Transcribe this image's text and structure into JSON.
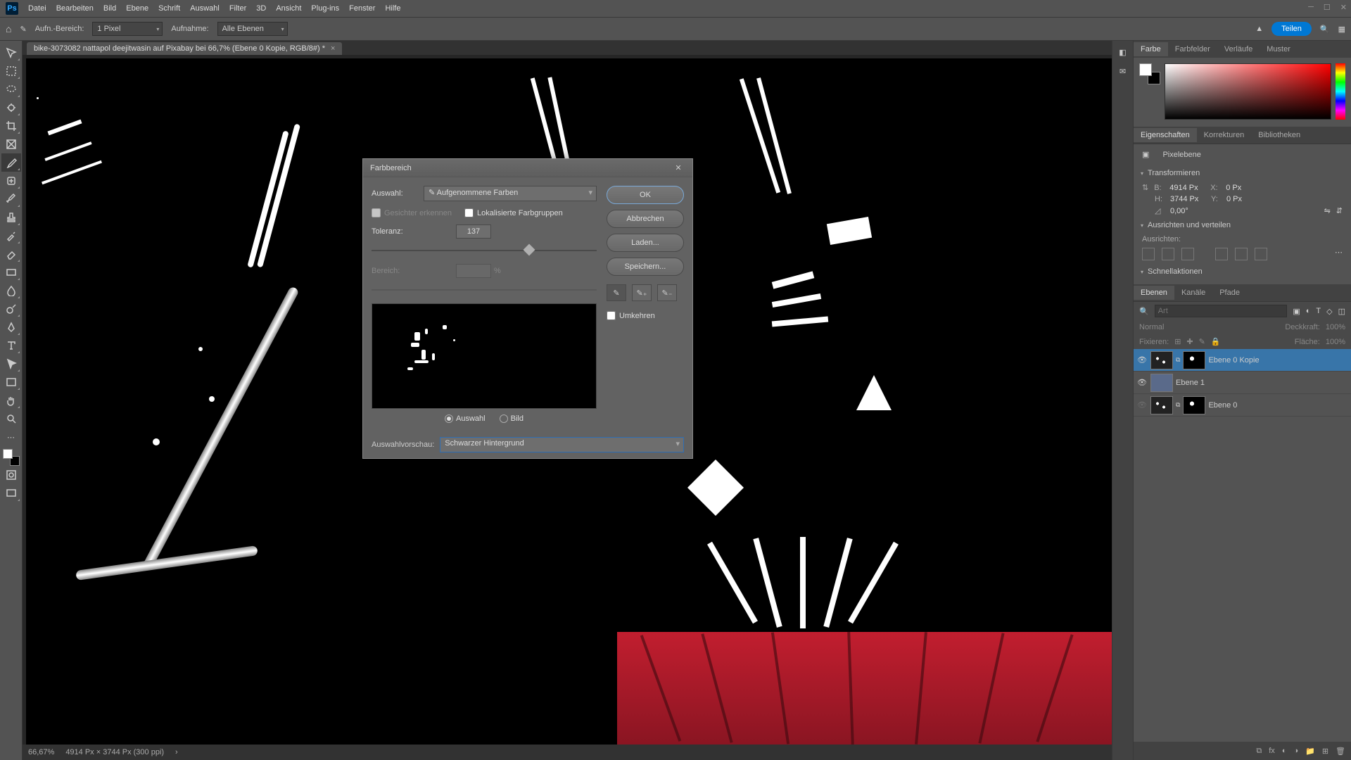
{
  "menu": {
    "items": [
      "Datei",
      "Bearbeiten",
      "Bild",
      "Ebene",
      "Schrift",
      "Auswahl",
      "Filter",
      "3D",
      "Ansicht",
      "Plug-ins",
      "Fenster",
      "Hilfe"
    ]
  },
  "optionsbar": {
    "aufn_label": "Aufn.-Bereich:",
    "aufn_value": "1 Pixel",
    "aufnahme_label": "Aufnahme:",
    "aufnahme_value": "Alle Ebenen",
    "share": "Teilen"
  },
  "document": {
    "tab_title": "bike-3073082 nattapol deejitwasin auf Pixabay bei 66,7% (Ebene 0 Kopie, RGB/8#) *"
  },
  "status": {
    "zoom": "66,67%",
    "doc": "4914 Px × 3744 Px (300 ppi)"
  },
  "panels": {
    "color_tabs": [
      "Farbe",
      "Farbfelder",
      "Verläufe",
      "Muster"
    ],
    "props_tabs": [
      "Eigenschaften",
      "Korrekturen",
      "Bibliotheken"
    ],
    "props_header": "Pixelebene",
    "transform": "Transformieren",
    "b_label": "B:",
    "b_val": "4914 Px",
    "x_label": "X:",
    "x_val": "0 Px",
    "h_label": "H:",
    "h_val": "3744 Px",
    "y_label": "Y:",
    "y_val": "0 Px",
    "angle": "0,00°",
    "align": "Ausrichten und verteilen",
    "align_sub": "Ausrichten:",
    "quick": "Schnellaktionen",
    "layer_tabs": [
      "Ebenen",
      "Kanäle",
      "Pfade"
    ],
    "layer_search_ph": "Art",
    "blend": "Normal",
    "opacity_label": "Deckkraft:",
    "opacity": "100%",
    "lock_label": "Fixieren:",
    "fill_label": "Fläche:",
    "fill": "100%",
    "layers": [
      {
        "name": "Ebene 0 Kopie",
        "vis": true,
        "mask": true,
        "sel": true
      },
      {
        "name": "Ebene 1",
        "vis": true,
        "mask": false,
        "sel": false,
        "solid": true
      },
      {
        "name": "Ebene 0",
        "vis": false,
        "mask": true,
        "sel": false
      }
    ]
  },
  "dialog": {
    "title": "Farbbereich",
    "auswahl_label": "Auswahl:",
    "auswahl_value": "Aufgenommene Farben",
    "gesichter": "Gesichter erkennen",
    "lokalisierte": "Lokalisierte Farbgruppen",
    "toleranz_label": "Toleranz:",
    "toleranz_value": "137",
    "toleranz_pct": 68,
    "bereich_label": "Bereich:",
    "bereich_unit": "%",
    "radio_auswahl": "Auswahl",
    "radio_bild": "Bild",
    "vorschau_label": "Auswahlvorschau:",
    "vorschau_value": "Schwarzer Hintergrund",
    "ok": "OK",
    "cancel": "Abbrechen",
    "laden": "Laden...",
    "speichern": "Speichern...",
    "umkehren": "Umkehren"
  }
}
